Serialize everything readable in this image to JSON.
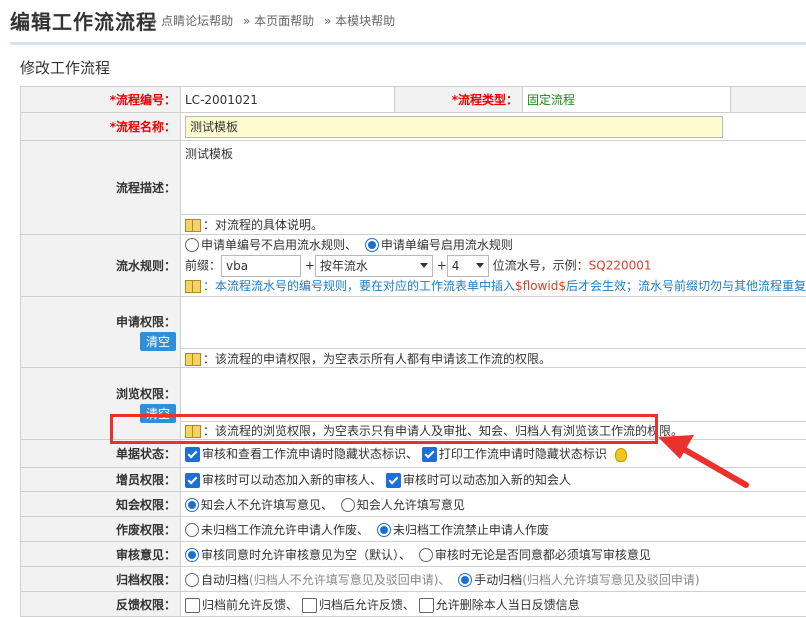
{
  "header": {
    "title": "编辑工作流流程",
    "links": [
      "» 点睛论坛帮助",
      "» 本页面帮助",
      "» 本模块帮助"
    ]
  },
  "panel": {
    "title": "修改工作流程"
  },
  "form": {
    "code": {
      "label": "*流程编号：",
      "value": "LC-2001021"
    },
    "type": {
      "label": "*流程类型：",
      "value": "固定流程"
    },
    "name": {
      "label": "*流程名称：",
      "value": "测试模板"
    },
    "desc": {
      "label": "流程描述：",
      "value": "测试模板",
      "hint": "：对流程的具体说明。"
    },
    "serial": {
      "label": "流水规则：",
      "opt1": "申请单编号不启用流水规则、",
      "opt2": "申请单编号启用流水规则",
      "prefix_label": "前缀：",
      "prefix_value": "vba",
      "plus": "+",
      "mode": "按年流水",
      "digits": "4",
      "digits_suffix": "位流水号，示例：",
      "example": "SQ220001",
      "hint_a": "：本流程流水号的编号规则，要在对应的工作流表单中插入",
      "hint_b": "$flowid$",
      "hint_c": "后才会生效；流水号前缀切勿与其他流程重复"
    },
    "apply": {
      "label": "申请权限：",
      "clear": "清空",
      "hint": "：该流程的申请权限，为空表示所有人都有申请该工作流的权限。"
    },
    "browse": {
      "label": "浏览权限：",
      "clear": "清空",
      "hint": "：该流程的浏览权限，为空表示只有申请人及审批、知会、归档人有浏览该工作流的权限。"
    },
    "status": {
      "label": "单据状态：",
      "opt1": "审核和查看工作流申请时隐藏状态标识、",
      "opt2": "打印工作流申请时隐藏状态标识"
    },
    "staff": {
      "label": "增员权限：",
      "opt1": "审核时可以动态加入新的审核人、",
      "opt2": "审核时可以动态加入新的知会人"
    },
    "notify": {
      "label": "知会权限：",
      "opt1": "知会人不允许填写意见、",
      "opt2": "知会人允许填写意见"
    },
    "void": {
      "label": "作废权限：",
      "opt1": "未归档工作流允许申请人作废、",
      "opt2": "未归档工作流禁止申请人作废"
    },
    "opinion": {
      "label": "审核意见：",
      "opt1": "审核同意时允许审核意见为空（默认）、",
      "opt2": "审核时无论是否同意都必须填写审核意见"
    },
    "archive": {
      "label": "归档权限：",
      "opt1": "自动归档",
      "opt1_note": "(归档人不允许填写意见及驳回申请)、",
      "opt2": "手动归档",
      "opt2_note": "(归档人允许填写意见及驳回申请)"
    },
    "feedback": {
      "label": "反馈权限：",
      "opt1": "归档前允许反馈、",
      "opt2": "归档后允许反馈、",
      "opt3": "允许删除本人当日反馈信息"
    }
  }
}
